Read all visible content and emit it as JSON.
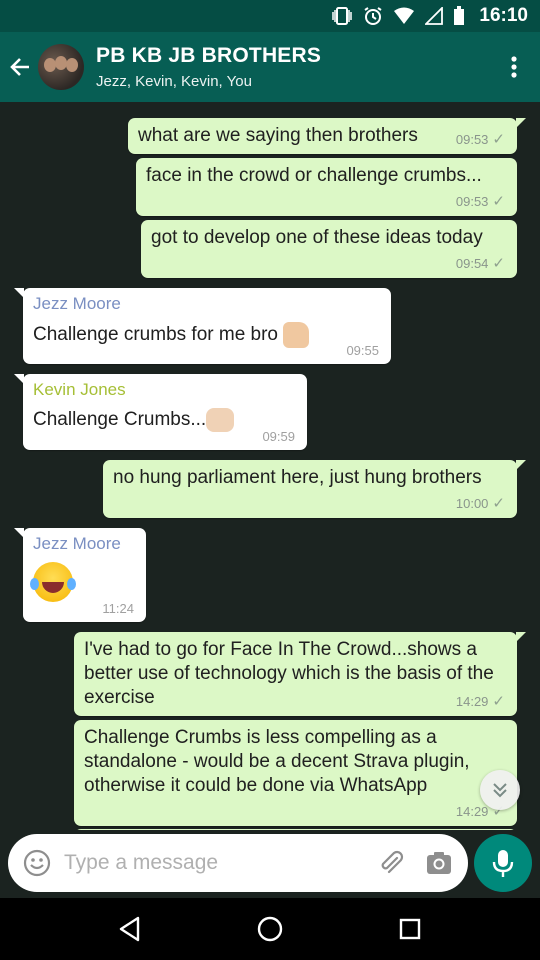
{
  "status": {
    "time": "16:10"
  },
  "header": {
    "title": "PB KB JB BROTHERS",
    "subtitle": "Jezz, Kevin, Kevin, You"
  },
  "messages": [
    {
      "dir": "out",
      "text": "what are we saying then brothers",
      "time": "09:53"
    },
    {
      "dir": "out",
      "text": "face in the crowd or challenge crumbs...",
      "time": "09:53"
    },
    {
      "dir": "out",
      "text": "got to develop one of these ideas today",
      "time": "09:54"
    },
    {
      "dir": "in",
      "sender": "Jezz Moore",
      "text": "Challenge crumbs for me bro",
      "emoji": "thumbs-up-emoji",
      "time": "09:55"
    },
    {
      "dir": "in",
      "sender": "Kevin Jones",
      "text": "Challenge Crumbs...",
      "emoji": "fist-bump-emoji",
      "time": "09:59"
    },
    {
      "dir": "out",
      "text": "no hung parliament here, just hung brothers",
      "time": "10:00"
    },
    {
      "dir": "in",
      "sender": "Jezz Moore",
      "text": "",
      "emoji": "tears-of-joy-emoji",
      "time": "11:24"
    },
    {
      "dir": "out",
      "text": "I've had to go for Face In The Crowd...shows a better use of technology which is the basis of the exercise",
      "time": "14:29"
    },
    {
      "dir": "out",
      "text": "Challenge Crumbs is less compelling as a standalone - would be a decent Strava plugin, otherwise it could be done via WhatsApp",
      "time": "14:29"
    }
  ],
  "composer": {
    "placeholder": "Type a message"
  },
  "colors": {
    "header": "#075e54",
    "outgoing": "#dcf8c6",
    "incoming": "#ffffff",
    "accent": "#00897b",
    "background": "#1b2320"
  }
}
